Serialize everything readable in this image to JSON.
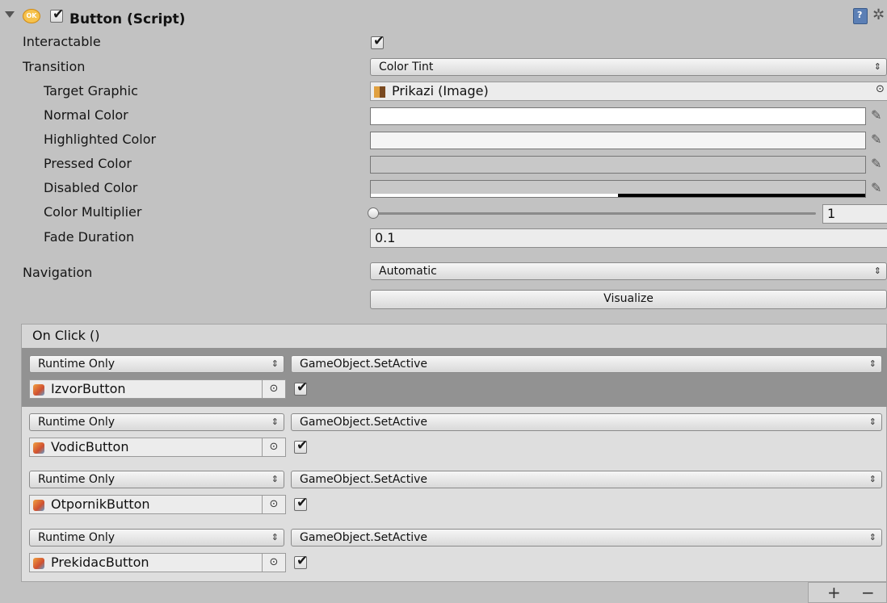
{
  "header": {
    "title": "Button (Script)",
    "badge": "OK",
    "enabled": true
  },
  "properties": {
    "interactable_label": "Interactable",
    "interactable_value": true,
    "transition_label": "Transition",
    "transition_value": "Color Tint",
    "target_graphic_label": "Target Graphic",
    "target_graphic_value": "Prikazi (Image)",
    "normal_color_label": "Normal Color",
    "normal_color_hex": "#ffffff",
    "highlighted_color_label": "Highlighted Color",
    "highlighted_color_hex": "#f5f5f5",
    "pressed_color_label": "Pressed Color",
    "pressed_color_hex": "#c8c8c8",
    "disabled_color_label": "Disabled Color",
    "disabled_color_hex": "#c8c8c8",
    "disabled_alpha": 0.5,
    "color_multiplier_label": "Color Multiplier",
    "color_multiplier_value": "1",
    "fade_duration_label": "Fade Duration",
    "fade_duration_value": "0.1",
    "navigation_label": "Navigation",
    "navigation_value": "Automatic",
    "visualize_label": "Visualize"
  },
  "on_click": {
    "title": "On Click ()",
    "entries": [
      {
        "mode": "Runtime Only",
        "function": "GameObject.SetActive",
        "target": "IzvorButton",
        "arg": true
      },
      {
        "mode": "Runtime Only",
        "function": "GameObject.SetActive",
        "target": "VodicButton",
        "arg": true
      },
      {
        "mode": "Runtime Only",
        "function": "GameObject.SetActive",
        "target": "OtpornikButton",
        "arg": true
      },
      {
        "mode": "Runtime Only",
        "function": "GameObject.SetActive",
        "target": "PrekidacButton",
        "arg": true
      }
    ],
    "add_label": "+",
    "remove_label": "−"
  },
  "icons": {
    "help": "help-book-icon",
    "settings": "gear-icon",
    "eyedropper": "eyedropper-icon",
    "object_picker": "object-picker-icon",
    "gameobject": "gameobject-cube-icon",
    "image_thumb": "image-thumbnail-icon"
  }
}
